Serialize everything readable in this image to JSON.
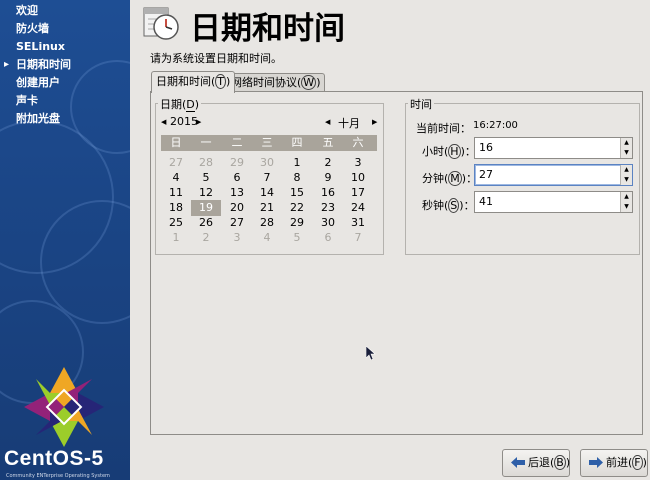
{
  "sidebar": {
    "items": [
      {
        "label": "欢迎"
      },
      {
        "label": "防火墙"
      },
      {
        "label": "SELinux"
      },
      {
        "label": "日期和时间"
      },
      {
        "label": "创建用户"
      },
      {
        "label": "声卡"
      },
      {
        "label": "附加光盘"
      }
    ],
    "active_index": 3,
    "logo_text": "CentOS-5",
    "logo_subtext": "Community ENTerprise Operating System"
  },
  "header": {
    "title": "日期和时间",
    "subtitle": "请为系统设置日期和时间。",
    "icon": "clock-calendar-icon"
  },
  "tabs": [
    {
      "label": "日期和时间",
      "accel": "T",
      "active": true
    },
    {
      "label": "网络时间协议",
      "accel": "W",
      "active": false
    }
  ],
  "date": {
    "legend": "日期",
    "legend_accel": "D",
    "year": "2015",
    "month": "十月",
    "weekdays": [
      "日",
      "一",
      "二",
      "三",
      "四",
      "五",
      "六"
    ],
    "weeks": [
      [
        "27",
        "28",
        "29",
        "30",
        "1",
        "2",
        "3"
      ],
      [
        "4",
        "5",
        "6",
        "7",
        "8",
        "9",
        "10"
      ],
      [
        "11",
        "12",
        "13",
        "14",
        "15",
        "16",
        "17"
      ],
      [
        "18",
        "19",
        "20",
        "21",
        "22",
        "23",
        "24"
      ],
      [
        "25",
        "26",
        "27",
        "28",
        "29",
        "30",
        "31"
      ],
      [
        "1",
        "2",
        "3",
        "4",
        "5",
        "6",
        "7"
      ]
    ],
    "selected_day": "19"
  },
  "time": {
    "legend": "时间",
    "current_label": "当前时间：",
    "current_value": "16:27:00",
    "hour_label": "小时",
    "hour_accel": "H",
    "hour_value": "16",
    "minute_label": "分钟",
    "minute_accel": "M",
    "minute_value": "27",
    "second_label": "秒钟",
    "second_accel": "S",
    "second_value": "41"
  },
  "buttons": {
    "back_label": "后退",
    "back_accel": "B",
    "next_label": "前进",
    "next_accel": "F"
  },
  "colors": {
    "sidebar_bg": "#1b4687",
    "calendar_header": "#a9a49b",
    "window_bg": "#e8e6e3"
  }
}
